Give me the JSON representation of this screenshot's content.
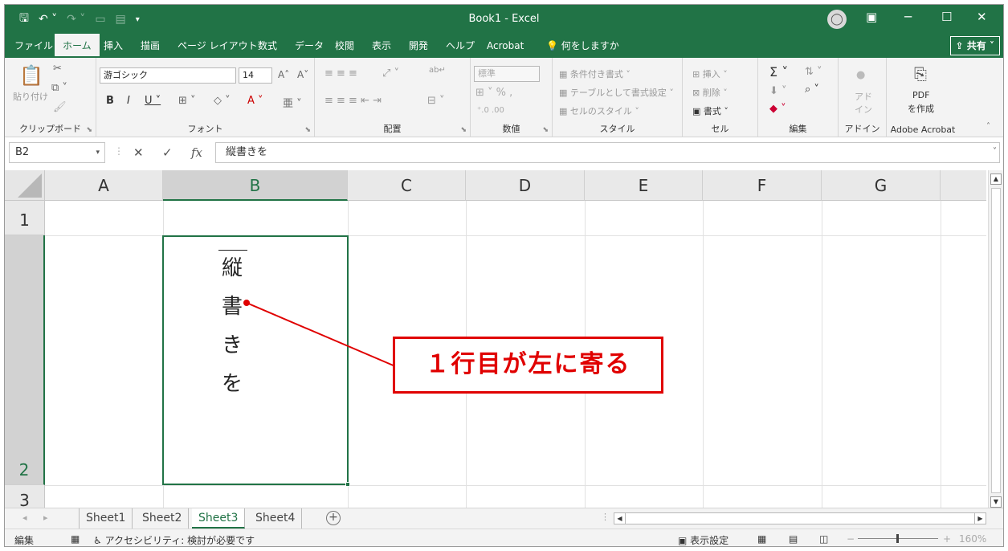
{
  "titlebar": {
    "title": "Book1  -  Excel",
    "save_icon": "save-icon",
    "undo_icon": "undo-icon",
    "redo_icon": "redo-icon"
  },
  "tabs": [
    "ファイル",
    "ホーム",
    "挿入",
    "描画",
    "ページ レイアウト",
    "数式",
    "データ",
    "校閲",
    "表示",
    "開発",
    "ヘルプ",
    "Acrobat"
  ],
  "tell_me": "何をしますか",
  "share_label": "共有",
  "ribbon": {
    "clipboard": {
      "paste_label": "貼り付け",
      "group_label": "クリップボード"
    },
    "font": {
      "font_name": "游ゴシック",
      "font_size": "14",
      "group_label": "フォント"
    },
    "alignment": {
      "group_label": "配置"
    },
    "number": {
      "format": "標準",
      "group_label": "数値"
    },
    "styles": {
      "conditional": "条件付き書式",
      "table": "テーブルとして書式設定",
      "cell_styles": "セルのスタイル",
      "group_label": "スタイル"
    },
    "cells": {
      "insert": "挿入",
      "delete": "削除",
      "format": "書式",
      "group_label": "セル"
    },
    "editing": {
      "group_label": "編集"
    },
    "addins": {
      "label": "アド\nイン",
      "group_label": "アドイン"
    },
    "acrobat": {
      "label1": "PDF",
      "label2": "を作成",
      "group_label": "Adobe Acrobat"
    }
  },
  "formula_bar": {
    "name_box": "B2",
    "cancel_icon": "✕",
    "enter_icon": "✓",
    "fx": "fx",
    "content": "縦書きを"
  },
  "grid": {
    "columns": [
      "A",
      "B",
      "C",
      "D",
      "E",
      "F",
      "G"
    ],
    "rows": [
      "1",
      "2",
      "3"
    ],
    "selected_column": "B",
    "selected_row": "2",
    "cell_b2_chars": [
      "縦",
      "書",
      "き",
      "を"
    ]
  },
  "callout": {
    "text": "１行目が左に寄る",
    "color": "#e00000"
  },
  "sheets": [
    "Sheet1",
    "Sheet2",
    "Sheet3",
    "Sheet4"
  ],
  "active_sheet": "Sheet3",
  "statusbar": {
    "mode": "編集",
    "accessibility": "アクセシビリティ: 検討が必要です",
    "display_settings": "表示設定",
    "zoom": "160%"
  },
  "colors": {
    "accent": "#217346",
    "callout_red": "#e00000"
  }
}
